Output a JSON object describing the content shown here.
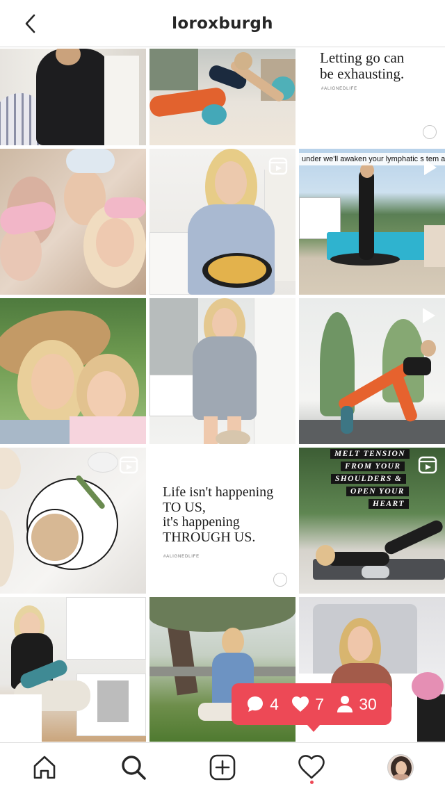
{
  "header": {
    "title": "loroxburgh",
    "back_icon": "chevron-left-icon"
  },
  "grid": {
    "posts": [
      {
        "kind": "photo",
        "subject": "woman in black sweater sitting"
      },
      {
        "kind": "photo",
        "subject": "woman stretching on yoga ball"
      },
      {
        "kind": "text",
        "quote_lines": [
          "Letting go can",
          "be exhausting."
        ],
        "tag": "#ALIGNEDLIFE"
      },
      {
        "kind": "photo",
        "subject": "mother and daughters with bunny ears"
      },
      {
        "kind": "video",
        "subject": "woman holding skillet frittata",
        "badge_icon": "reel-icon"
      },
      {
        "kind": "video",
        "subject": "woman bouncing on rebounder by pool",
        "badge_icon": "play-icon",
        "caption": "under we'll awaken your lymphatic s   tem a"
      },
      {
        "kind": "photo",
        "subject": "mother and child selfie with hat"
      },
      {
        "kind": "photo",
        "subject": "woman in robe by bathtub"
      },
      {
        "kind": "video",
        "subject": "woman in lunge yoga pose",
        "badge_icon": "play-icon"
      },
      {
        "kind": "video",
        "subject": "latte on white plate",
        "badge_icon": "reel-icon"
      },
      {
        "kind": "text",
        "quote_lines": [
          "Life isn't happening",
          "TO US,",
          "it's happening",
          "THROUGH US."
        ],
        "tag": "#ALIGNEDLIFE"
      },
      {
        "kind": "video",
        "subject": "woman on foam roller",
        "badge_icon": "reel-icon",
        "overlay_lines": [
          "MELT TENSION",
          "FROM YOUR",
          "SHOULDERS &",
          "OPEN YOUR",
          "HEART"
        ]
      },
      {
        "kind": "photo",
        "subject": "woman in kitchen with yoga mat"
      },
      {
        "kind": "photo",
        "subject": "woman meditating outdoors"
      },
      {
        "kind": "photo",
        "subject": "woman sitting on bed"
      }
    ]
  },
  "notification": {
    "comments": "4",
    "likes": "7",
    "follows": "30",
    "color": "#ed4956"
  },
  "bottom_nav": {
    "items": [
      "home-icon",
      "search-icon",
      "new-post-icon",
      "activity-heart-icon",
      "profile-avatar"
    ]
  }
}
